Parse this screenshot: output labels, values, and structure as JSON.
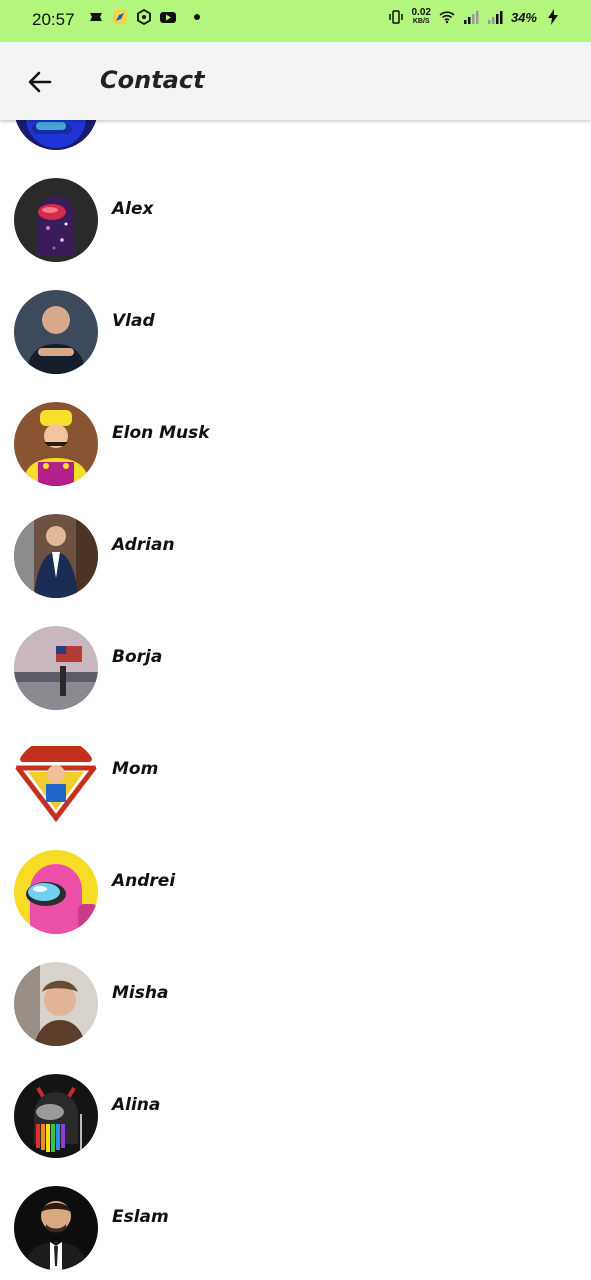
{
  "status_bar": {
    "time": "20:57",
    "speed_value": "0.02",
    "speed_unit": "KB/S",
    "battery": "34%",
    "icons": [
      "notification-icon",
      "compass-icon",
      "hexagon-icon",
      "youtube-icon",
      "dot-icon",
      "vibrate-icon",
      "wifi-icon",
      "signal-icon",
      "signal-icon-2",
      "charging-icon"
    ]
  },
  "app_bar": {
    "title": "Contact",
    "back_icon": "arrow-left-icon"
  },
  "contacts": [
    {
      "name": "Alex"
    },
    {
      "name": "Vlad"
    },
    {
      "name": "Elon Musk"
    },
    {
      "name": "Adrian"
    },
    {
      "name": "Borja"
    },
    {
      "name": "Mom"
    },
    {
      "name": "Andrei"
    },
    {
      "name": "Misha"
    },
    {
      "name": "Alina"
    },
    {
      "name": "Eslam"
    }
  ],
  "colors": {
    "status_bar_bg": "#b2f67e",
    "app_bar_bg": "#f3f3f3",
    "list_bg": "#ffffff"
  }
}
